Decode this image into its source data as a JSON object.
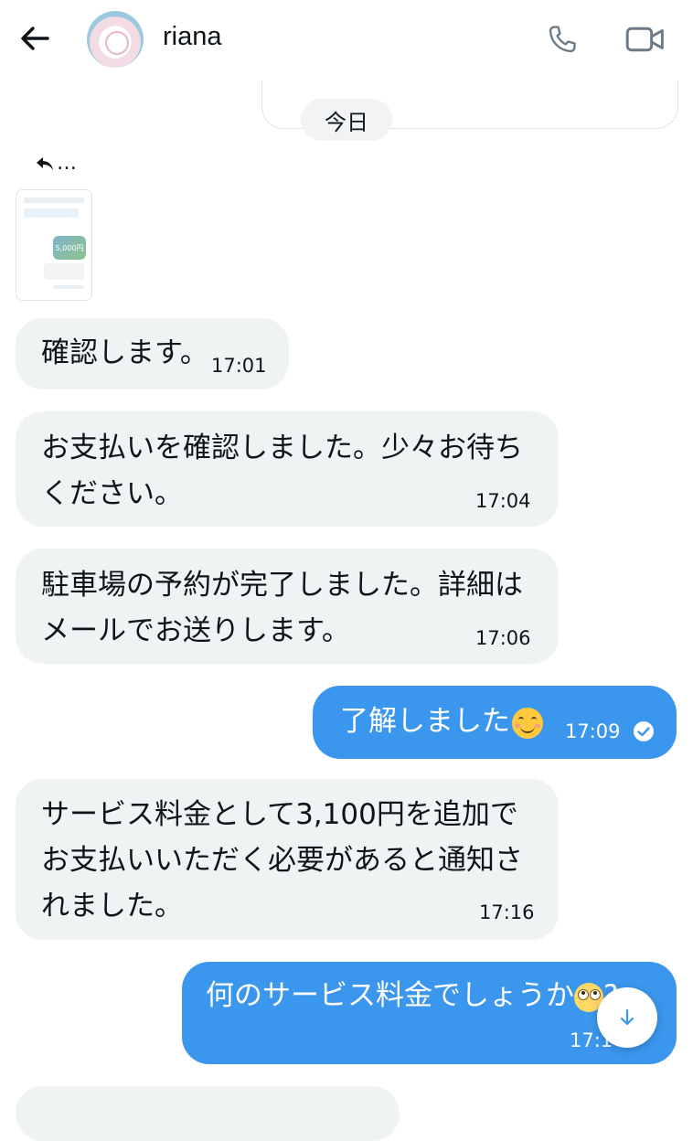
{
  "header": {
    "contact_name": "riana",
    "icons": [
      "back-arrow-icon",
      "phone-icon",
      "video-icon"
    ]
  },
  "date_divider": "今日",
  "attachment": {
    "amount": "5,000円"
  },
  "messages": [
    {
      "direction": "in",
      "lines": [
        "確認します。"
      ],
      "time": "17:01"
    },
    {
      "direction": "in",
      "lines": [
        "お支払いを確認しました。少々お待ち",
        "ください。"
      ],
      "time": "17:04"
    },
    {
      "direction": "in",
      "lines": [
        "駐車場の予約が完了しました。詳細は",
        "メールでお送りします。"
      ],
      "time": "17:06"
    },
    {
      "direction": "out",
      "lines": [
        "了解しました"
      ],
      "emoji": "smiling-face",
      "time": "17:09",
      "status": "read"
    },
    {
      "direction": "in",
      "lines": [
        "サービス料金として3,100円を追加で",
        "お支払いいただく必要があると通知さ",
        "れました。"
      ],
      "time": "17:16"
    },
    {
      "direction": "out",
      "lines": [
        "何のサービス料金でしょうか"
      ],
      "emoji": "face-with-rolling-eyes",
      "suffix": "?",
      "time": "17:1"
    }
  ],
  "colors": {
    "incoming_bubble": "#eff3f4",
    "outgoing_bubble": "#3b97ee",
    "text": "#0f1419"
  }
}
